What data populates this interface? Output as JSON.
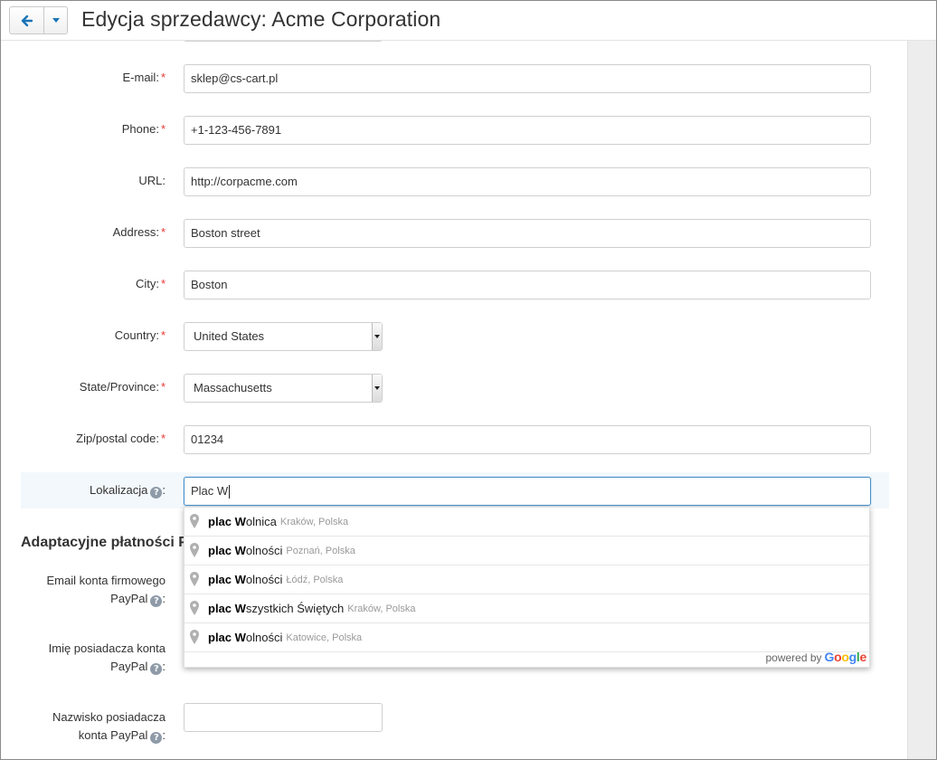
{
  "header": {
    "title": "Edycja sprzedawcy: Acme Corporation"
  },
  "form": {
    "email": {
      "label": "E-mail:",
      "value": "sklep@cs-cart.pl",
      "required": "*"
    },
    "phone": {
      "label": "Phone:",
      "value": "+1-123-456-7891",
      "required": "*"
    },
    "url": {
      "label": "URL:",
      "value": "http://corpacme.com"
    },
    "address": {
      "label": "Address:",
      "value": "Boston street",
      "required": "*"
    },
    "city": {
      "label": "City:",
      "value": "Boston",
      "required": "*"
    },
    "country": {
      "label": "Country:",
      "value": "United States",
      "required": "*"
    },
    "state": {
      "label": "State/Province:",
      "value": "Massachusetts",
      "required": "*"
    },
    "zip": {
      "label": "Zip/postal code:",
      "value": "01234",
      "required": "*"
    },
    "location": {
      "label": "Lokalizacja",
      "value": "Plac W",
      "colon": ":"
    }
  },
  "section": {
    "title": "Adaptacyjne płatności Pa"
  },
  "paypal": {
    "email_label_1": "Email konta firmowego",
    "email_label_2": "PayPal",
    "first_name_label_1": "Imię posiadacza konta",
    "first_name_label_2": "PayPal",
    "last_name_label_1": "Nazwisko posiadacza",
    "last_name_label_2": "konta PayPal",
    "colon": ":"
  },
  "help_glyph": "?",
  "autocomplete": {
    "items": [
      {
        "bold": "plac W",
        "rest": "olnica",
        "secondary": "Kraków, Polska"
      },
      {
        "bold": "plac W",
        "rest": "olności",
        "secondary": "Poznań, Polska"
      },
      {
        "bold": "plac W",
        "rest": "olności",
        "secondary": "Łódź, Polska"
      },
      {
        "bold": "plac W",
        "rest": "szystkich Świętych",
        "secondary": "Kraków, Polska"
      },
      {
        "bold": "plac W",
        "rest": "olności",
        "secondary": "Katowice, Polska"
      }
    ],
    "powered_by": "powered by",
    "logo": {
      "g1": "G",
      "g2": "o",
      "g3": "o",
      "g4": "g",
      "g5": "l",
      "g6": "e"
    }
  },
  "colors": {
    "accent": "#4a90c8",
    "required": "#e53935",
    "highlight_row": "#f3f8fc",
    "back_arrow": "#1a73b8"
  },
  "icons": [
    "arrow-left-icon",
    "caret-down-icon",
    "help-icon",
    "map-pin-icon",
    "google-logo"
  ]
}
